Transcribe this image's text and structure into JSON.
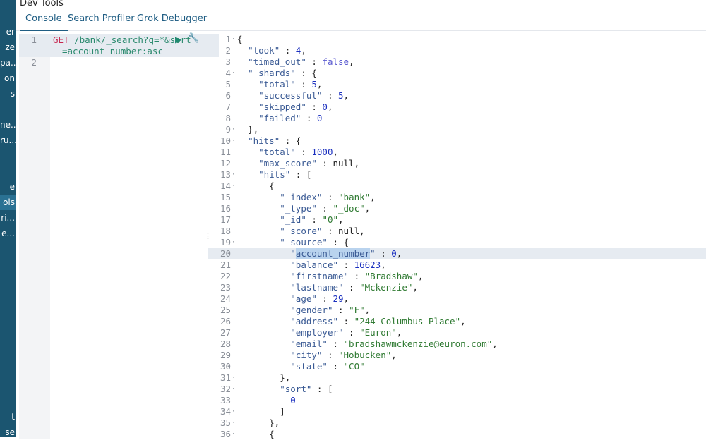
{
  "sidebar": {
    "items": [
      {
        "label": "er"
      },
      {
        "label": "ze"
      },
      {
        "label": "pa..."
      },
      {
        "label": "on"
      },
      {
        "label": "s"
      },
      {
        "label": ""
      },
      {
        "label": "ne..."
      },
      {
        "label": "ru..."
      },
      {
        "label": ""
      },
      {
        "label": "e"
      },
      {
        "label": "ols",
        "active": true
      },
      {
        "label": "ri..."
      },
      {
        "label": "e..."
      },
      {
        "label": "t"
      },
      {
        "label": "se"
      }
    ]
  },
  "header": {
    "title": "Dev Tools",
    "tabs": [
      {
        "label": "Console",
        "active": true
      },
      {
        "label": "Search Profiler"
      },
      {
        "label": "Grok Debugger"
      }
    ]
  },
  "input": {
    "line_numbers": [
      "1",
      "2"
    ],
    "method": "GET",
    "path": " /bank/_search?q=*&sort",
    "path_cont": "=account_number:asc",
    "run_icon": "play-icon",
    "settings_icon": "wrench-icon"
  },
  "output": {
    "highlighted_line": 20,
    "selected_text": "account_number",
    "lines": [
      "{",
      "  \"took\" : 4,",
      "  \"timed_out\" : false,",
      "  \"_shards\" : {",
      "    \"total\" : 5,",
      "    \"successful\" : 5,",
      "    \"skipped\" : 0,",
      "    \"failed\" : 0",
      "  },",
      "  \"hits\" : {",
      "    \"total\" : 1000,",
      "    \"max_score\" : null,",
      "    \"hits\" : [",
      "      {",
      "        \"_index\" : \"bank\",",
      "        \"_type\" : \"_doc\",",
      "        \"_id\" : \"0\",",
      "        \"_score\" : null,",
      "        \"_source\" : {",
      "          \"account_number\" : 0,",
      "          \"balance\" : 16623,",
      "          \"firstname\" : \"Bradshaw\",",
      "          \"lastname\" : \"Mckenzie\",",
      "          \"age\" : 29,",
      "          \"gender\" : \"F\",",
      "          \"address\" : \"244 Columbus Place\",",
      "          \"employer\" : \"Euron\",",
      "          \"email\" : \"bradshawmckenzie@euron.com\",",
      "          \"city\" : \"Hobucken\",",
      "          \"state\" : \"CO\"",
      "        },",
      "        \"sort\" : [",
      "          0",
      "        ]",
      "      },",
      "      {"
    ],
    "foldable": [
      1,
      4,
      9,
      10,
      13,
      14,
      19,
      31,
      32,
      34,
      35,
      36
    ]
  }
}
